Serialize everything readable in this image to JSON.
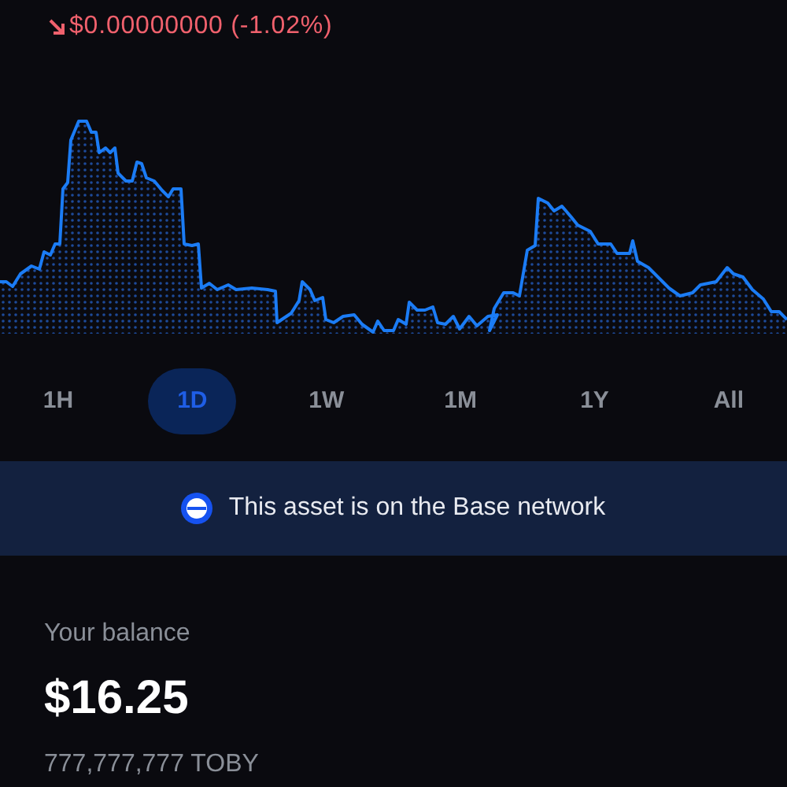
{
  "price_change": {
    "down": true,
    "text": "$0.00000000 (-1.02%)"
  },
  "ranges": [
    {
      "label": "1H",
      "selected": false
    },
    {
      "label": "1D",
      "selected": true
    },
    {
      "label": "1W",
      "selected": false
    },
    {
      "label": "1M",
      "selected": false
    },
    {
      "label": "1Y",
      "selected": false
    },
    {
      "label": "All",
      "selected": false
    }
  ],
  "network_banner": {
    "text": "This asset is on the Base network"
  },
  "balance": {
    "label": "Your balance",
    "value": "$16.25",
    "amount": "777,777,777 TOBY"
  }
}
